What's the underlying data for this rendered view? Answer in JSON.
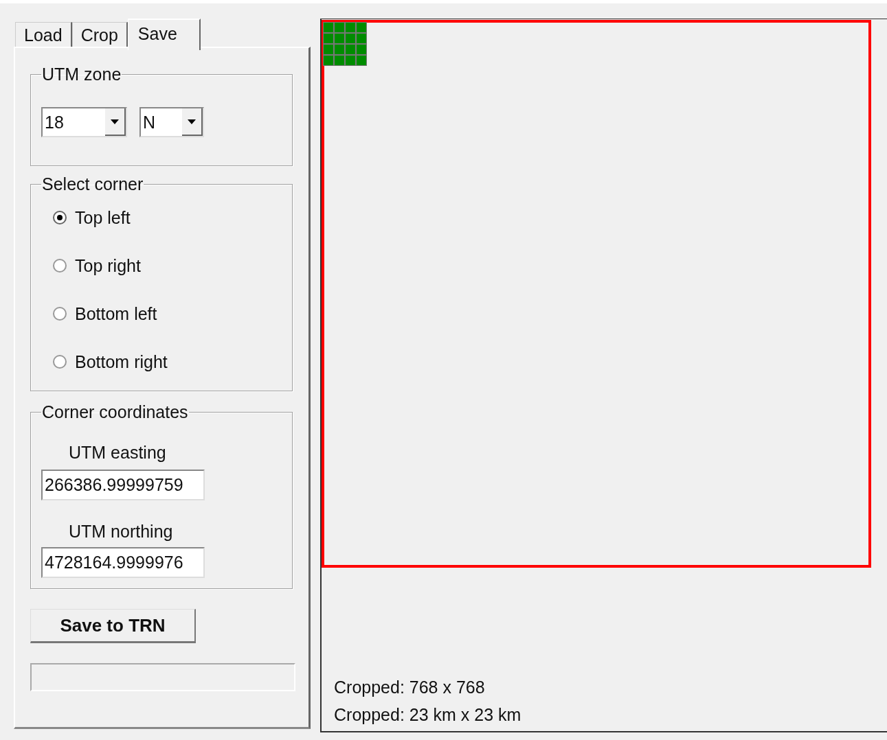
{
  "tabs": [
    {
      "label": "Load",
      "selected": false
    },
    {
      "label": "Crop",
      "selected": false
    },
    {
      "label": "Save",
      "selected": true
    }
  ],
  "utm_zone": {
    "title": "UTM zone",
    "zone": "18",
    "hemisphere": "N"
  },
  "select_corner": {
    "title": "Select corner",
    "options": [
      {
        "label": "Top left",
        "selected": true
      },
      {
        "label": "Top right",
        "selected": false
      },
      {
        "label": "Bottom left",
        "selected": false
      },
      {
        "label": "Bottom right",
        "selected": false
      }
    ]
  },
  "corner_coordinates": {
    "title": "Corner coordinates",
    "fields": [
      {
        "label": "UTM easting",
        "value": "266386.99999759"
      },
      {
        "label": "UTM northing",
        "value": "4728164.9999976"
      }
    ]
  },
  "save_button": "Save to TRN",
  "preview": {
    "info": [
      "Cropped: 768 x 768",
      "Cropped: 23 km x 23 km"
    ]
  }
}
